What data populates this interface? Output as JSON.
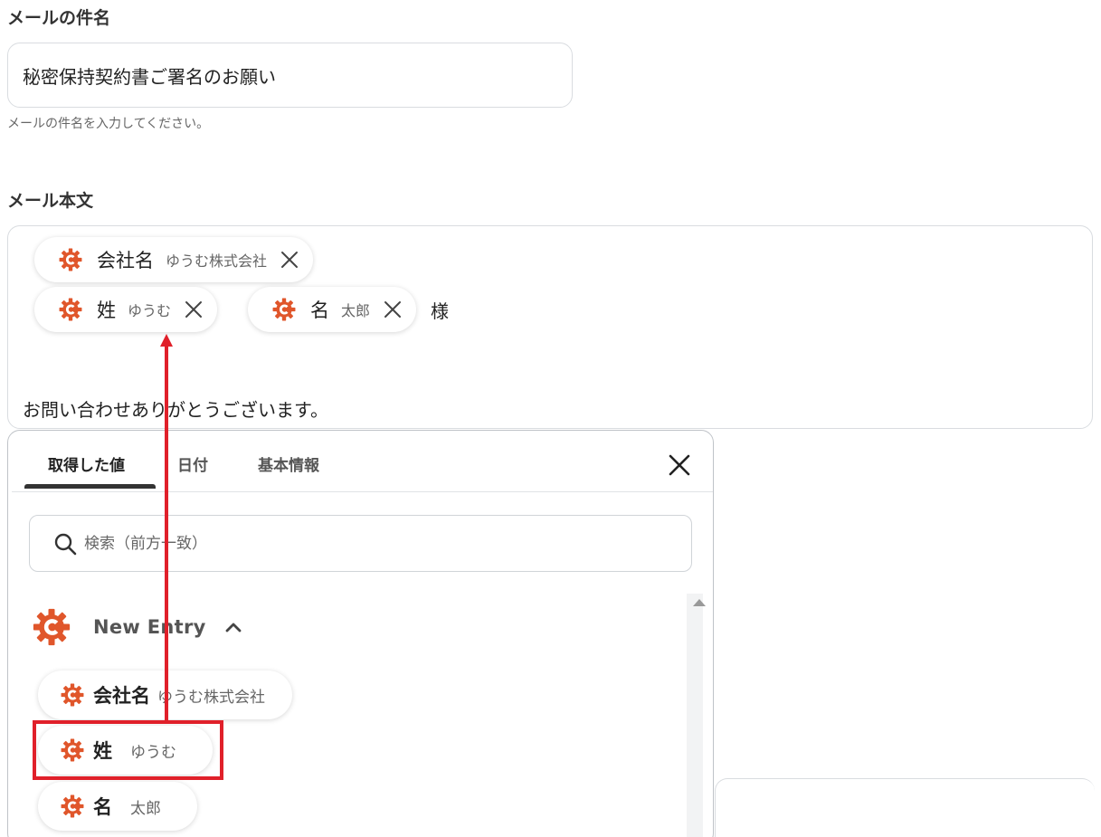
{
  "subject": {
    "label": "メールの件名",
    "value": "秘密保持契約書ご署名のお願い",
    "help": "メールの件名を入力してください。"
  },
  "body": {
    "label": "メール本文",
    "chips": [
      {
        "name": "会社名",
        "value": "ゆうむ株式会社"
      },
      {
        "name": "姓",
        "value": "ゆうむ"
      },
      {
        "name": "名",
        "value": "太郎"
      }
    ],
    "suffix": "様",
    "text_line": "お問い合わせありがとうございます。"
  },
  "picker": {
    "tabs": [
      "取得した値",
      "日付",
      "基本情報"
    ],
    "active_tab": 0,
    "search_placeholder": "検索（前方一致）",
    "group_title": "New Entry",
    "items": [
      {
        "name": "会社名",
        "value": "ゆうむ株式会社"
      },
      {
        "name": "姓",
        "value": "ゆうむ"
      },
      {
        "name": "名",
        "value": "太郎"
      }
    ]
  },
  "colors": {
    "accent": "#e0202a",
    "brand_gear": "#e0562b"
  },
  "icons": [
    "gear-logo-icon",
    "close-icon",
    "search-icon",
    "chevron-up-icon"
  ]
}
